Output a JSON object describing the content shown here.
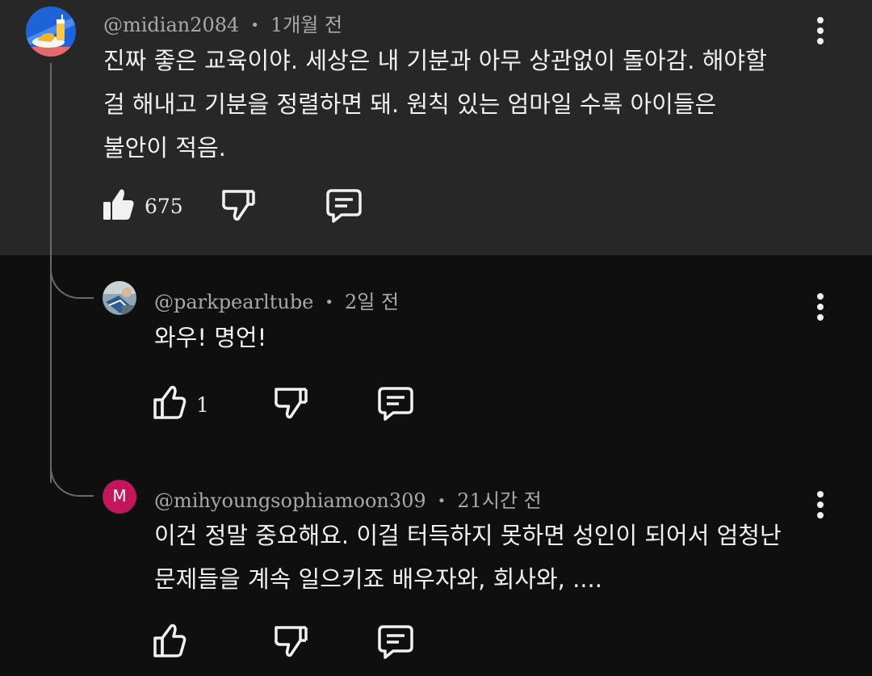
{
  "comments": [
    {
      "author": "@midian2084",
      "time": "1개월 전",
      "lines": [
        "진짜 좋은 교육이야. 세상은 내 기분과 아무 상관없이 돌아감. 해야할",
        "걸 해내고 기분을 정렬하면 돼. 원칙 있는 엄마일 수록 아이들은",
        "불안이 적음."
      ],
      "likes": "675"
    },
    {
      "author": "@parkpearltube",
      "time": "2일 전",
      "lines": [
        "와우! 명언!"
      ],
      "likes": "1"
    },
    {
      "author": "@mihyoungsophiamoon309",
      "time": "21시간 전",
      "avatar_letter": "M",
      "lines": [
        "이건 정말 중요해요. 이걸 터득하지 못하면 성인이 되어서 엄청난",
        "문제들을 계속 일으키죠 배우자와, 회사와, ...."
      ]
    }
  ],
  "separator": "•",
  "colors": {
    "top_bg": "#272727",
    "bg": "#0f0f0f",
    "meta": "#a8a8a8",
    "avatar_m": "#c2185b"
  }
}
